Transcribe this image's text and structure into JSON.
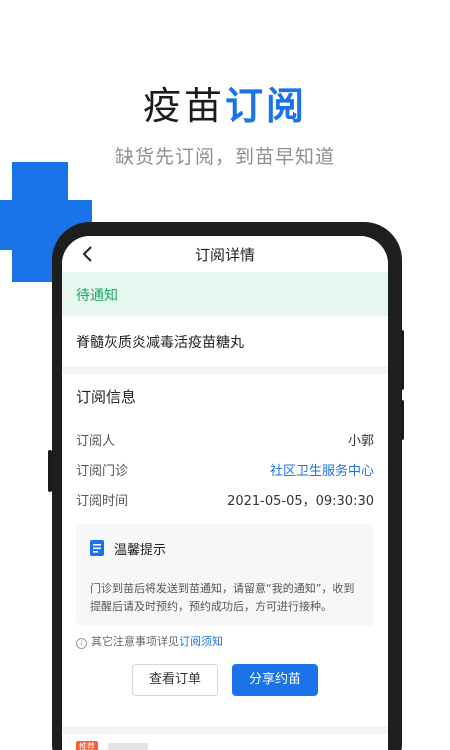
{
  "promo": {
    "title_main": "疫苗",
    "title_accent": "订阅",
    "subtitle": "缺货先订阅，到苗早知道"
  },
  "header": {
    "title": "订阅详情",
    "back_icon": "chevron-left-icon"
  },
  "status": {
    "label": "待通知"
  },
  "vaccine": {
    "name": "脊髓灰质炎减毒活疫苗糖丸"
  },
  "subscription_info": {
    "section_title": "订阅信息",
    "rows": [
      {
        "label": "订阅人",
        "value": "小郭"
      },
      {
        "label": "订阅门诊",
        "value": "社区卫生服务中心"
      },
      {
        "label": "订阅时间",
        "value": "2021-05-05，09:30:30"
      }
    ]
  },
  "tip": {
    "icon": "document-icon",
    "title": "温馨提示",
    "text": "门诊到苗后将发送到苗通知，请留意“我的通知”，收到提醒后请及时预约，预约成功后，方可进行接种。"
  },
  "note": {
    "icon": "info-icon",
    "prefix": "其它注意事项详见",
    "link": "订阅须知"
  },
  "actions": {
    "view_order": "查看订单",
    "share": "分享约苗"
  },
  "recommend": {
    "tag": "推荐"
  },
  "colors": {
    "accent": "#1a73e8",
    "status_green": "#19a866",
    "status_bg": "#e7f7ef",
    "tag_orange": "#ff5b2e"
  }
}
